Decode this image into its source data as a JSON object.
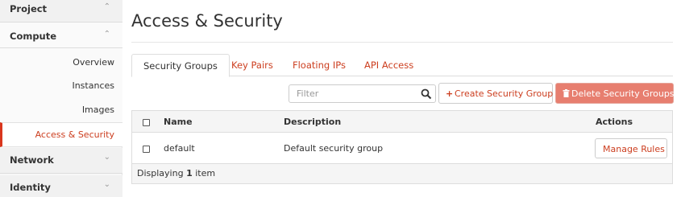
{
  "sidebar": {
    "project": {
      "label": "Project",
      "chevron": "up"
    },
    "compute": {
      "label": "Compute",
      "chevron": "up",
      "items": [
        {
          "label": "Overview"
        },
        {
          "label": "Instances"
        },
        {
          "label": "Images"
        },
        {
          "label": "Access & Security",
          "active": true
        }
      ]
    },
    "network": {
      "label": "Network",
      "chevron": "down"
    },
    "identity": {
      "label": "Identity",
      "chevron": "down"
    }
  },
  "main": {
    "title": "Access & Security",
    "tabs": [
      {
        "label": "Security Groups",
        "active": true
      },
      {
        "label": "Key Pairs"
      },
      {
        "label": "Floating IPs"
      },
      {
        "label": "API Access"
      }
    ],
    "filter": {
      "placeholder": "Filter",
      "value": "",
      "icon": "search-icon"
    },
    "create_button": {
      "label": "Create Security Group",
      "icon": "plus-icon"
    },
    "delete_button": {
      "label": "Delete Security Groups",
      "icon": "trash-icon"
    },
    "table": {
      "columns": [
        "Name",
        "Description",
        "Actions"
      ],
      "rows": [
        {
          "name": "default",
          "description": "Default security group",
          "action": "Manage Rules"
        }
      ],
      "footer": {
        "prefix": "Displaying",
        "count": "1",
        "suffix": "item"
      }
    }
  },
  "colors": {
    "accent": "#cc3e1f",
    "danger": "#e77e6f",
    "sidebar_bg": "#f7f7f7",
    "header_bg": "#f5f5f5"
  }
}
